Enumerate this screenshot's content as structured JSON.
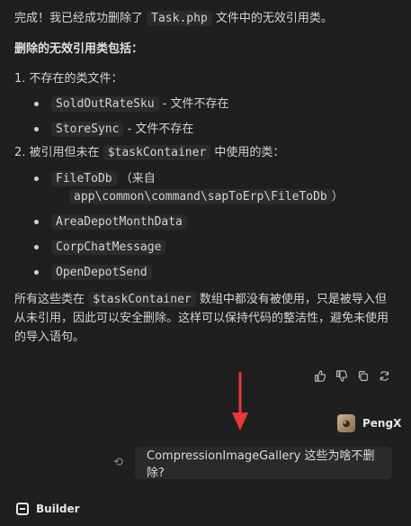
{
  "message": {
    "intro_prefix": "完成！我已经成功删除了",
    "intro_code": "Task.php",
    "intro_suffix": "文件中的无效引用类。",
    "heading": "删除的无效引用类包括：",
    "section1": {
      "number": "1.",
      "title": "不存在的类文件：",
      "items": [
        {
          "code": "SoldOutRateSku",
          "note": "- 文件不存在"
        },
        {
          "code": "StoreSync",
          "note": "- 文件不存在"
        }
      ]
    },
    "section2": {
      "number": "2.",
      "title_prefix": "被引用但未在",
      "title_code": "$taskContainer",
      "title_suffix": "中使用的类：",
      "items": [
        {
          "code": "FileToDb",
          "note": "（来自",
          "code2": "app\\common\\command\\sapToErp\\FileToDb",
          "close": "）"
        },
        {
          "code": "AreaDepotMonthData"
        },
        {
          "code": "CorpChatMessage"
        },
        {
          "code": "OpenDepotSend"
        }
      ]
    },
    "summary_prefix": "所有这些类在",
    "summary_code": "$taskContainer",
    "summary_suffix": "数组中都没有被使用，只是被导入但从未引用，因此可以安全删除。这样可以保持代码的整洁性，避免未使用的导入语句。"
  },
  "actions": {
    "icons": [
      "thumbs-up-icon",
      "thumbs-down-icon",
      "copy-icon",
      "refresh-icon"
    ]
  },
  "user": {
    "name": "PengX"
  },
  "user_message": {
    "text": "CompressionImageGallery 这些为啥不删除?"
  },
  "footer": {
    "assistant_name": "Builder"
  },
  "colors": {
    "background": "#1f1f1f",
    "annotation_arrow": "#e53935"
  }
}
